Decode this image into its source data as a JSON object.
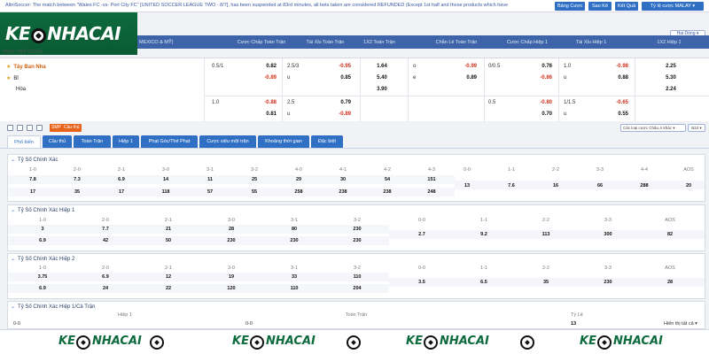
{
  "topbar": {
    "announcement": "AltriiSoccer: The match between \"Wales FC -vs- Port City FC\" [UNITED SOCCER LEAGUE TWO - 8/7], has been suspended at 83rd minutes, all bets taken are considered REFUNDED (Except 1st half and those products which have",
    "odds_btn": "Bảng Cược",
    "compare_btn": "Sao Kê",
    "results_btn": "Kết Quả",
    "oddstype_btn": "Tỷ lệ cược MALAY ▾"
  },
  "logo": {
    "left": "KE",
    "right": "NHACAI"
  },
  "header": {
    "league": "MEXICO & MỸ)",
    "match_time": "TRỰC TIẾP 02/05/2...",
    "sort_label": "Hai Dòng ▾",
    "columns": [
      "Cược Chấp Toàn Trận",
      "Tài Xỉu Toàn Trận",
      "1X2 Toàn Trận",
      "Chẵn Lẻ Toàn Trận",
      "Cược Chấp Hiệp 1",
      "Tài Xỉu Hiệp 1",
      "1X2 Hiệp 1"
    ]
  },
  "match": {
    "home": "Tây Ban Nha",
    "away": "Bỉ",
    "draw": "Hòa",
    "rows": [
      {
        "hdp_line": "0.5/1",
        "hdp_home": "0.82",
        "hdp_away": "-0.89",
        "ou_line": "2.5/3",
        "ou_over": "-0.95",
        "ou_u": "u",
        "ou_under": "0.85",
        "x12": [
          "1.64",
          "5.40",
          "3.90"
        ],
        "oe_o": "o",
        "oe_over": "-0.99",
        "oe_e": "e",
        "oe_even": "0.89",
        "h1_hdp_line": "0/0.5",
        "h1_hdp_home": "0.76",
        "h1_hdp_away": "-0.86",
        "h1_ou_line": "1.0",
        "h1_ou_over": "-0.98",
        "h1_ou_u": "u",
        "h1_ou_under": "0.88",
        "h1_x12": [
          "2.25",
          "5.30",
          "2.24"
        ]
      },
      {
        "hdp_line": "1.0",
        "hdp_home": "-0.88",
        "hdp_away": "0.81",
        "ou_line": "2.5",
        "ou_over": "0.79",
        "ou_u": "u",
        "ou_under": "-0.89",
        "h1_hdp_line": "0.5",
        "h1_hdp_home": "-0.80",
        "h1_hdp_away": "0.70",
        "h1_ou_line": "1/1.5",
        "h1_ou_over": "-0.65",
        "h1_ou_u": "u",
        "h1_ou_under": "0.55"
      }
    ]
  },
  "toolrow": {
    "smp_badge": "SMP",
    "live_badge": "Cầu thủ",
    "market_filter": "Các loại cược Châu Á khác ▾",
    "market_count": "B24 ▾"
  },
  "tabs": [
    "Phổ biến",
    "Cầu thủ",
    "Toàn Trận",
    "Hiệp 1",
    "Phạt Góc/Thẻ Phạt",
    "Cược siêu một trận",
    "Khoảng thời gian",
    "Đặc biệt"
  ],
  "sections": {
    "cs_full": {
      "title": "Tỷ Số Chính Xác",
      "left_headers": [
        "1-0",
        "2-0",
        "2-1",
        "3-0",
        "3-1",
        "3-2",
        "4-0",
        "4-1",
        "4-2",
        "4-3"
      ],
      "left_row1": [
        "7.8",
        "7.3",
        "6.9",
        "14",
        "11",
        "25",
        "29",
        "30",
        "54",
        "151"
      ],
      "left_row2": [
        "17",
        "35",
        "17",
        "118",
        "57",
        "55",
        "258",
        "238",
        "238",
        "248"
      ],
      "right_headers": [
        "0-0",
        "1-1",
        "2-2",
        "3-3",
        "4-4",
        "AOS"
      ],
      "right_values": [
        "13",
        "7.6",
        "16",
        "66",
        "288",
        "20"
      ]
    },
    "cs_h1": {
      "title": "Tỷ Số Chính Xác Hiệp 1",
      "left_headers": [
        "1-0",
        "2-0",
        "2-1",
        "3-0",
        "3-1",
        "3-2"
      ],
      "left_row1": [
        "3",
        "7.7",
        "21",
        "28",
        "80",
        "230"
      ],
      "left_row2": [
        "6.9",
        "42",
        "50",
        "230",
        "230",
        "230"
      ],
      "right_headers": [
        "0-0",
        "1-1",
        "2-2",
        "3-3",
        "AOS"
      ],
      "right_values": [
        "2.7",
        "9.2",
        "113",
        "300",
        "82"
      ]
    },
    "cs_h2": {
      "title": "Tỷ Số Chính Xác Hiệp 2",
      "left_headers": [
        "1-0",
        "2-0",
        "2-1",
        "3-0",
        "3-1",
        "3-2"
      ],
      "left_row1": [
        "3.75",
        "6.9",
        "12",
        "19",
        "33",
        "110"
      ],
      "left_row2": [
        "6.9",
        "24",
        "22",
        "120",
        "110",
        "204"
      ],
      "right_headers": [
        "0-0",
        "1-1",
        "2-2",
        "3-3",
        "AOS"
      ],
      "right_values": [
        "3.5",
        "6.5",
        "35",
        "230",
        "28"
      ]
    },
    "ht_ft": {
      "title": "Tỷ Số Chính Xác Hiệp 1/Cả Trận",
      "headers": [
        "Hiệp 1",
        "Toàn Trận",
        "Tỷ Lệ"
      ],
      "values": [
        "0-0",
        "0-0",
        "13"
      ],
      "more": "Hiển thị tất cả ▾"
    }
  },
  "footer": {
    "left": "KE",
    "right": "NHACAI"
  }
}
